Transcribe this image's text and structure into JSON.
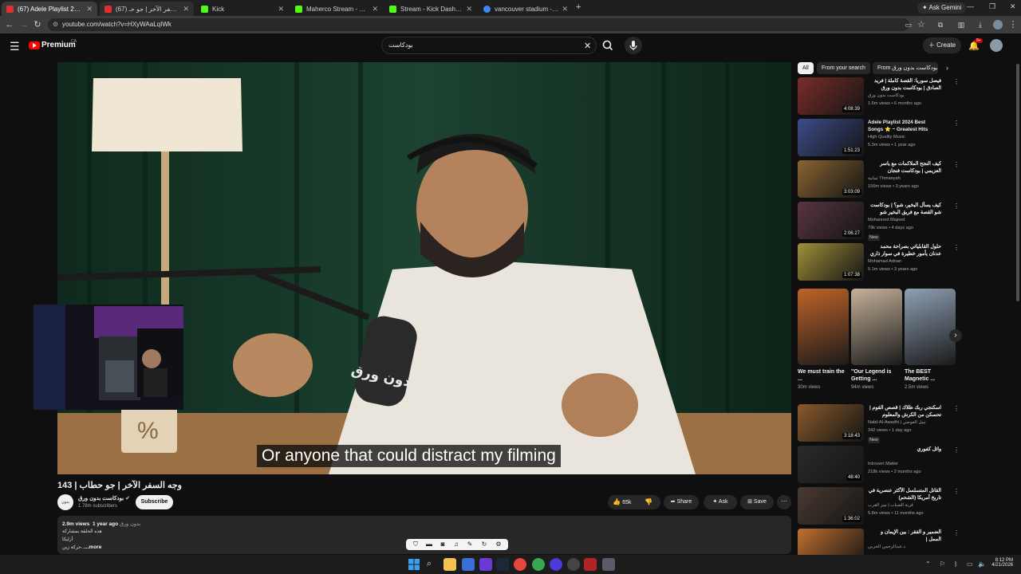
{
  "browser": {
    "tabs": [
      {
        "title": "(67) Adele Playlist 2024 Best So...",
        "icon": "youtube-icon",
        "color": "#e03030"
      },
      {
        "title": "(67) وجه السفر الآخر | جو حـ...",
        "icon": "youtube-icon",
        "color": "#e03030"
      },
      {
        "title": "Kick",
        "icon": "kick-icon",
        "color": "#53fc18"
      },
      {
        "title": "Maherco Stream - Watch Live o...",
        "icon": "kick-icon",
        "color": "#53fc18"
      },
      {
        "title": "Stream - Kick Dashboard",
        "icon": "kick-icon",
        "color": "#53fc18"
      },
      {
        "title": "vancouver stadium - Google Se...",
        "icon": "google-icon",
        "color": "#4285f4"
      }
    ],
    "url": "youtube.com/watch?v=HXyWAaLqIWk",
    "ask_gemini": "Ask Gemini"
  },
  "youtube": {
    "logo": "Premium",
    "region": "CA",
    "search_query": "بودكاست",
    "create_label": "Create",
    "notif_count": "9+"
  },
  "player": {
    "caption": "Or anyone that could distract my filming",
    "mic_text": "بدون ورق"
  },
  "video": {
    "title": "وجه السفر الآخر | جو حطاب | 143",
    "channel": "بودكاست بدون ورق",
    "subscribers": "1.78m subscribers",
    "subscribe": "Subscribe",
    "likes": "65k",
    "share": "Share",
    "ask": "Ask",
    "save": "Save",
    "views": "2.9m views",
    "age": "1 year ago",
    "tag": "بدون ورق",
    "desc1": "هذه الحلقة بمشاركة",
    "desc2": "أرليكا",
    "desc3": "حركة زين...",
    "more": "...more"
  },
  "filters": [
    {
      "label": "All",
      "selected": true
    },
    {
      "label": "From your search",
      "selected": false
    },
    {
      "label": "From بودكاست بدون ورق",
      "selected": false
    }
  ],
  "recommendations": [
    {
      "title": "فيصل سوريا: القصة كاملة | فريد الصادق | بودكاست بدون ورق",
      "channel": "بودكاست بدون ورق",
      "meta": "1.6m views • 6 months ago",
      "duration": "4:08:39",
      "bg": "#7a2d28",
      "badge": ""
    },
    {
      "title": "Adele Playlist 2024 Best Songs ⭐ ~ Greatest Hits Album 🌟",
      "channel": "High Quality Music",
      "meta": "5.3m views • 1 year ago",
      "duration": "1:51:23",
      "bg": "#3d4c8a",
      "badge": ""
    },
    {
      "title": "كيف النجح الملاكمات مع ياسر العزيمي | بودكاست فنجان",
      "channel": "ثمانية Thmanyah",
      "meta": "156m views • 3 years ago",
      "duration": "3:03:09",
      "bg": "#8a6430",
      "badge": ""
    },
    {
      "title": "كيف يسأل البخير، شو؟ | بودكاست شو القصة مع فريق البخير شو الحكم فرعي - علي",
      "channel": "Mohanned Majeed",
      "meta": "79k views • 4 days ago",
      "duration": "2:06:27",
      "bg": "#5a3540",
      "badge": "New"
    },
    {
      "title": "حلول القابلياتي بصراحة محمد عدنان يأمور خطيرة في سوار ذاري | 🤷",
      "channel": "Mohamad Adnan",
      "meta": "5.1m views • 3 years ago",
      "duration": "1:07:38",
      "bg": "#a08f3a",
      "badge": ""
    },
    {
      "title": "اسكنجي ربك ظلاك | قصص القوم | تحسكن من الكرش والمعلوم",
      "channel": "Nabil Al-Awadhi | نبيل العوضي",
      "meta": "342 views • 1 day ago",
      "duration": "3:18:43",
      "bg": "#8a5a2a",
      "badge": "New"
    },
    {
      "title": "وائل كفوري",
      "channel": "Introvert Matter",
      "meta": "218k views • 2 months ago",
      "duration": "48:40",
      "bg": "#2a2a2a",
      "badge": ""
    },
    {
      "title": "القاتل المتسلسل الأكثر عنصرية في تاريخ أمريكا (الشحم)",
      "channel": "قرية الضباب | ميز الغرب",
      "meta": "5.8m views • 11 months ago",
      "duration": "1:36:02",
      "bg": "#4a3a30",
      "badge": ""
    },
    {
      "title": "الضمير و الفقر : بين الإيمان و الممل |",
      "channel": "د.عبدالرحمن الحربي",
      "meta": "",
      "duration": "",
      "bg": "#c07030",
      "badge": ""
    }
  ],
  "shorts": [
    {
      "title": "We must train the ...",
      "views": "30m views",
      "bg": "#c06428"
    },
    {
      "title": "\"Our Legend is Getting ...",
      "views": "94m views",
      "bg": "#c6b29a"
    },
    {
      "title": "The BEST Magnetic ...",
      "views": "2.5m views",
      "bg": "#8fa0b4"
    }
  ],
  "taskbar": {
    "time": "8:12 PM",
    "date": "4/21/2026"
  },
  "colors": {
    "bg": "#0f0f0f",
    "accent": "#ff0000",
    "chip": "#272727"
  }
}
